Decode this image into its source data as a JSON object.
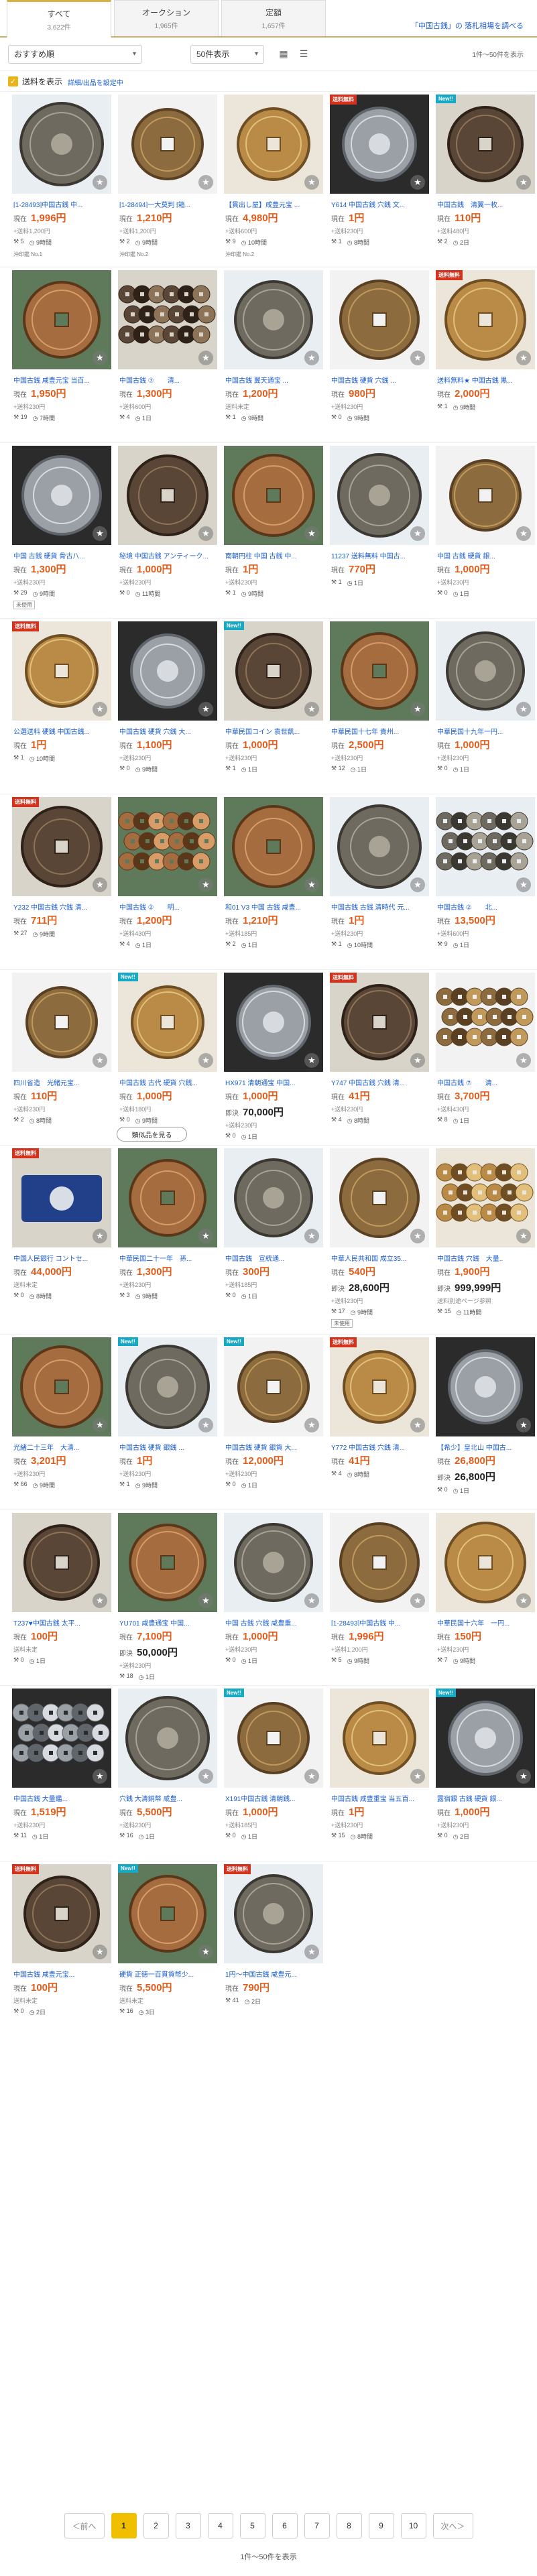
{
  "tabs": [
    {
      "label": "すべて",
      "count": "3,622件"
    },
    {
      "label": "オークション",
      "count": "1,965件"
    },
    {
      "label": "定額",
      "count": "1,657件"
    }
  ],
  "tab_link": "「中国古銭」の 落札相場を調べる",
  "sort": {
    "value": "おすすめ順"
  },
  "per_page": {
    "value": "50件表示"
  },
  "range_text": "1件〜50件を表示",
  "filter": {
    "label": "送料を表示",
    "sub": "詳細/出品を設定中"
  },
  "colors": {
    "accent": "#d8b14a",
    "price": "#e05d1b",
    "link": "#1a5cd1",
    "free": "#d5321e",
    "new": "#17a8c4"
  },
  "rows": [
    {
      "items": [
        {
          "title": "[1-28493]中国古銭 中...",
          "price": "1,996円",
          "price2": "",
          "ship": "+送料1,200円",
          "bids": "5",
          "time": "9時間",
          "img": "coin1",
          "foot": "沖印鑑 No.1"
        },
        {
          "title": "[1-28494]一大莫判 [箱...",
          "price": "1,210円",
          "price2": "",
          "ship": "+送料1,200円",
          "bids": "2",
          "time": "9時間",
          "img": "coin2",
          "foot": "沖印鑑 No.2"
        },
        {
          "title": "【貫出し屋】咸豊元宝 ...",
          "price": "4,980円",
          "price2": "",
          "ship": "+送料600円",
          "bids": "9",
          "time": "10時間",
          "img": "coin3",
          "foot": "沖印鑑 No.2"
        },
        {
          "title": "Y614 中国古銭 穴銭 文...",
          "price": "1円",
          "price2": "",
          "ship": "+送料230円",
          "bids": "1",
          "time": "8時間",
          "img": "coin4",
          "badge": "free"
        },
        {
          "title": "中国古銭　清翼一枚...",
          "price": "110円",
          "price2": "",
          "ship": "+送料480円",
          "bids": "2",
          "time": "2日",
          "img": "coin5",
          "badge": "new"
        }
      ]
    },
    {
      "items": [
        {
          "title": "中国古銭 咸豊元宝 当百...",
          "price": "1,950円",
          "ship": "+送料230円",
          "bids": "19",
          "time": "7時間",
          "img": "coin6"
        },
        {
          "title": "中国古銭 ⑦　　清...",
          "price": "1,300円",
          "ship": "+送料600円",
          "bids": "4",
          "time": "1日",
          "img": "pile1"
        },
        {
          "title": "中国古銭 翼天通宝 ...",
          "price": "1,200円",
          "ship": "送料未定",
          "bids": "1",
          "time": "9時間",
          "img": "coin7"
        },
        {
          "title": "中国古銭 硬貨 穴銭 ...",
          "price": "980円",
          "ship": "+送料230円",
          "bids": "0",
          "time": "9時間",
          "img": "coin8"
        },
        {
          "title": "送料無料★ 中国古銭 黒...",
          "price": "2,000円",
          "ship": "",
          "bids": "1",
          "time": "9時間",
          "img": "coin9",
          "badge": "free"
        }
      ]
    },
    {
      "items": [
        {
          "title": "中国 古銭 硬貨 骨古八...",
          "price": "1,300円",
          "ship": "+送料230円",
          "bids": "29",
          "time": "9時間",
          "img": "coin10",
          "tag": "未使用"
        },
        {
          "title": "秘境 中国古銭 アンティーク...",
          "price": "1,000円",
          "ship": "+送料230円",
          "bids": "0",
          "time": "11時間",
          "img": "coin11"
        },
        {
          "title": "南朝円柱 中国 古銭 中...",
          "price": "1円",
          "ship": "+送料230円",
          "bids": "1",
          "time": "9時間",
          "img": "coin12"
        },
        {
          "title": "11237 送料無料 中国古...",
          "price": "770円",
          "ship": "",
          "bids": "1",
          "time": "1日",
          "img": "coin13"
        },
        {
          "title": "中国 古銭 硬貨 銀...",
          "price": "1,000円",
          "ship": "+送料230円",
          "bids": "0",
          "time": "1日",
          "img": "coin14"
        }
      ]
    },
    {
      "items": [
        {
          "title": "公選送料 硬銭 中国古銭...",
          "price": "1円",
          "ship": "",
          "bids": "1",
          "time": "10時間",
          "img": "coin15",
          "badge": "free"
        },
        {
          "title": "中国古銭 硬貨 穴銭 大...",
          "price": "1,100円",
          "ship": "+送料230円",
          "bids": "0",
          "time": "9時間",
          "img": "coin16"
        },
        {
          "title": "中華民国コイン 袁世凱...",
          "price": "1,000円",
          "ship": "+送料230円",
          "bids": "1",
          "time": "1日",
          "img": "coin17",
          "badge": "new"
        },
        {
          "title": "中華民国十七年 貴州...",
          "price": "2,500円",
          "ship": "+送料230円",
          "bids": "12",
          "time": "1日",
          "img": "coin18"
        },
        {
          "title": "中華民国十九年一円...",
          "price": "1,000円",
          "ship": "+送料230円",
          "bids": "0",
          "time": "1日",
          "img": "coin19"
        }
      ]
    },
    {
      "items": [
        {
          "title": "Y232 中国古銭 穴銭 清...",
          "price": "711円",
          "ship": "",
          "bids": "27",
          "time": "9時間",
          "img": "coin20",
          "badge": "free"
        },
        {
          "title": "中国古銭 ②　　明...",
          "price": "1,200円",
          "ship": "+送料430円",
          "bids": "4",
          "time": "1日",
          "img": "pile2"
        },
        {
          "title": "和01 V3 中国 古銭 咸豊...",
          "price": "1,210円",
          "ship": "+送料185円",
          "bids": "2",
          "time": "1日",
          "img": "coin21"
        },
        {
          "title": "中国古銭 古銭 清時代 元...",
          "price": "1円",
          "ship": "+送料230円",
          "bids": "1",
          "time": "10時間",
          "img": "coin22"
        },
        {
          "title": "中国古銭 ②　　北...",
          "price": "13,500円",
          "ship": "+送料600円",
          "bids": "9",
          "time": "1日",
          "img": "pile3"
        }
      ]
    },
    {
      "items": [
        {
          "title": "四川省造　光緒元宝...",
          "price": "110円",
          "ship": "+送料230円",
          "bids": "2",
          "time": "8時間",
          "img": "coin23"
        },
        {
          "title": "中国古銭 古代 硬貨 穴銭...",
          "price": "1,000円",
          "ship": "+送料180円",
          "bids": "0",
          "time": "9時間",
          "img": "coin24",
          "badge": "new"
        },
        {
          "title": "HX971 清朝通宝 中国...",
          "price": "1,000円",
          "price2": "70,000円",
          "ship": "+送料230円",
          "bids": "0",
          "time": "1日",
          "img": "coin25"
        },
        {
          "title": "Y747 中国古銭 穴銭 清...",
          "price": "41円",
          "ship": "+送料230円",
          "bids": "4",
          "time": "8時間",
          "img": "coin26",
          "badge": "free"
        },
        {
          "title": "中国古銭 ⑦　　清...",
          "price": "3,700円",
          "ship": "+送料430円",
          "bids": "8",
          "time": "1日",
          "img": "pile4"
        }
      ]
    },
    {
      "items": [
        {
          "title": "中国人民銀行 コントセ...",
          "price": "44,000円",
          "ship": "送料未定",
          "bids": "0",
          "time": "8時間",
          "img": "box1",
          "badge": "free"
        },
        {
          "title": "中華民国二十一年　孫...",
          "price": "1,300円",
          "ship": "+送料230円",
          "bids": "3",
          "time": "9時間",
          "img": "coin27"
        },
        {
          "title": "中国古銭　宣統通...",
          "price": "300円",
          "ship": "+送料185円",
          "bids": "0",
          "time": "1日",
          "img": "coin28"
        },
        {
          "title": "中華人民共和国 成立35...",
          "price": "540円",
          "price2": "28,600円",
          "ship": "+送料230円",
          "bids": "17",
          "time": "9時間",
          "img": "coin29",
          "tag": "未使用"
        },
        {
          "title": "中国古銭 穴銭　大量..",
          "price": "1,900円",
          "price2": "999,999円",
          "ship": "送料別途ページ参照",
          "bids": "15",
          "time": "11時間",
          "img": "pile5"
        }
      ]
    },
    {
      "items": [
        {
          "title": "光緒二十三年　大清...",
          "price": "3,201円",
          "ship": "+送料230円",
          "bids": "66",
          "time": "9時間",
          "img": "coin30"
        },
        {
          "title": "中国古銭 硬貨 銀銭 ...",
          "price": "1円",
          "ship": "+送料230円",
          "bids": "1",
          "time": "9時間",
          "img": "coin31",
          "badge": "new"
        },
        {
          "title": "中国古銭 硬貨 銀貨 大...",
          "price": "12,000円",
          "ship": "+送料230円",
          "bids": "0",
          "time": "1日",
          "img": "coin32",
          "badge": "new"
        },
        {
          "title": "Y772 中国古銭 穴銭 清...",
          "price": "41円",
          "ship": "",
          "bids": "4",
          "time": "8時間",
          "img": "coin33",
          "badge": "free"
        },
        {
          "title": "【希少】皇北山 中国古...",
          "price": "26,800円",
          "price2": "26,800円",
          "ship": "",
          "bids": "0",
          "time": "1日",
          "img": "coin34"
        }
      ]
    },
    {
      "items": [
        {
          "title": "T237♥中国古銭 太平...",
          "price": "100円",
          "ship": "送料未定",
          "bids": "0",
          "time": "1日",
          "img": "coin35"
        },
        {
          "title": "YU701 咸豊通宝 中国...",
          "price": "7,100円",
          "price2": "50,000円",
          "ship": "+送料230円",
          "bids": "18",
          "time": "1日",
          "img": "coin36"
        },
        {
          "title": "中国 古銭 穴銭 咸豊重...",
          "price": "1,000円",
          "ship": "+送料230円",
          "bids": "0",
          "time": "1日",
          "img": "coin37"
        },
        {
          "title": "[1-28493]中国古銭 中...",
          "price": "1,996円",
          "ship": "+送料1,200円",
          "bids": "5",
          "time": "9時間",
          "img": "coin38"
        },
        {
          "title": "中華民国十六年　一円...",
          "price": "150円",
          "ship": "+送料230円",
          "bids": "7",
          "time": "9時間",
          "img": "coin39"
        }
      ]
    },
    {
      "items": [
        {
          "title": "中国古銭 大量鑑...",
          "price": "1,519円",
          "ship": "+送料230円",
          "bids": "11",
          "time": "1日",
          "img": "pile6"
        },
        {
          "title": "穴銭 大清銅幣 咸豊...",
          "price": "5,500円",
          "ship": "+送料230円",
          "bids": "16",
          "time": "1日",
          "img": "coin40"
        },
        {
          "title": "X191中国古銭 清朝銭...",
          "price": "1,000円",
          "ship": "+送料185円",
          "bids": "0",
          "time": "1日",
          "img": "coin41",
          "badge": "new"
        },
        {
          "title": "中国古銭 咸豊重宝 当五百...",
          "price": "1円",
          "ship": "+送料230円",
          "bids": "15",
          "time": "8時間",
          "img": "coin42"
        },
        {
          "title": "露宿銀 古銭 硬貨 銀...",
          "price": "1,000円",
          "ship": "+送料230円",
          "bids": "0",
          "time": "2日",
          "img": "coin43",
          "badge": "new"
        }
      ]
    },
    {
      "items": [
        {
          "title": "中国古銭 咸豊元宝...",
          "price": "100円",
          "ship": "送料未定",
          "bids": "0",
          "time": "2日",
          "img": "coin44",
          "badge": "free"
        },
        {
          "title": "硬貨 正徳一百貫貨幣少...",
          "price": "5,500円",
          "ship": "送料未定",
          "bids": "16",
          "time": "3日",
          "img": "coin45",
          "badge": "new"
        },
        {
          "title": "1円〜中国古銭 咸豊元...",
          "price": "790円",
          "ship": "",
          "bids": "41",
          "time": "2日",
          "img": "coin46",
          "badge": "free"
        }
      ]
    }
  ],
  "more_label": "類似品を見る",
  "labels": {
    "now": "現在",
    "instant": "即決",
    "free_badge": "送料無料",
    "new_badge": "New!!"
  },
  "pager": {
    "prev": "＜前へ",
    "next": "次へ＞",
    "pages": [
      "1",
      "2",
      "3",
      "4",
      "5",
      "6",
      "7",
      "8",
      "9",
      "10"
    ],
    "current": "1",
    "summary": "1件〜50件を表示"
  }
}
